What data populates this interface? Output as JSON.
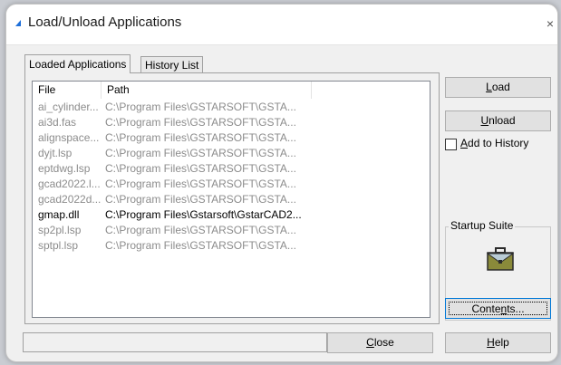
{
  "window": {
    "title": "Load/Unload Applications",
    "close_glyph": "×"
  },
  "tabs": [
    {
      "label": "Loaded Applications",
      "active": true
    },
    {
      "label": "History List",
      "active": false
    }
  ],
  "list": {
    "columns": [
      "File",
      "Path"
    ],
    "rows": [
      {
        "file": "ai_cylinder...",
        "path": "C:\\Program Files\\GSTARSOFT\\GSTA...",
        "loaded": false
      },
      {
        "file": "ai3d.fas",
        "path": "C:\\Program Files\\GSTARSOFT\\GSTA...",
        "loaded": false
      },
      {
        "file": "alignspace...",
        "path": "C:\\Program Files\\GSTARSOFT\\GSTA...",
        "loaded": false
      },
      {
        "file": "dyjt.lsp",
        "path": "C:\\Program Files\\GSTARSOFT\\GSTA...",
        "loaded": false
      },
      {
        "file": "eptdwg.lsp",
        "path": "C:\\Program Files\\GSTARSOFT\\GSTA...",
        "loaded": false
      },
      {
        "file": "gcad2022.l...",
        "path": "C:\\Program Files\\GSTARSOFT\\GSTA...",
        "loaded": false
      },
      {
        "file": "gcad2022d...",
        "path": "C:\\Program Files\\GSTARSOFT\\GSTA...",
        "loaded": false
      },
      {
        "file": "gmap.dll",
        "path": "C:\\Program Files\\Gstarsoft\\GstarCAD2...",
        "loaded": true
      },
      {
        "file": "sp2pl.lsp",
        "path": "C:\\Program Files\\GSTARSOFT\\GSTA...",
        "loaded": false
      },
      {
        "file": "sptpl.lsp",
        "path": "C:\\Program Files\\GSTARSOFT\\GSTA...",
        "loaded": false
      }
    ]
  },
  "buttons": {
    "load_u": "L",
    "load_rest": "oad",
    "unload_u": "U",
    "unload_rest": "nload",
    "contents_pre": "Conte",
    "contents_u": "n",
    "contents_rest": "ts...",
    "close_u": "C",
    "close_rest": "lose",
    "help_u": "H",
    "help_rest": "elp"
  },
  "add_to_history": {
    "u": "A",
    "rest": "dd to History",
    "checked": false
  },
  "startup_suite": {
    "title": "Startup Suite",
    "icon": "briefcase-icon"
  },
  "status": {
    "text": ""
  },
  "colors": {
    "accent": "#0078d7",
    "title_icon": "#1e6fd9",
    "unloaded_text": "#8c8c8c",
    "loaded_text": "#000000"
  }
}
